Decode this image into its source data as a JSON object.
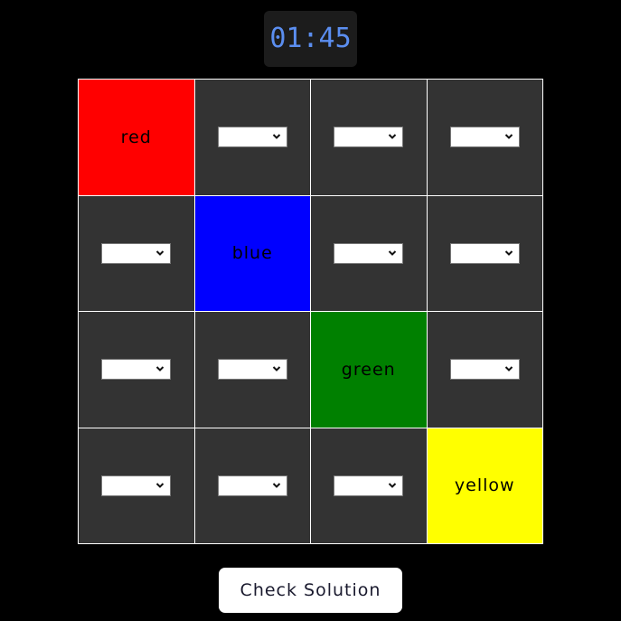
{
  "timer": {
    "value": "01:45",
    "color": "#5b8ef0"
  },
  "grid": {
    "rows": [
      [
        {
          "type": "fixed",
          "label": "red",
          "color": "#ff0000"
        },
        {
          "type": "select",
          "value": ""
        },
        {
          "type": "select",
          "value": ""
        },
        {
          "type": "select",
          "value": ""
        }
      ],
      [
        {
          "type": "select",
          "value": ""
        },
        {
          "type": "fixed",
          "label": "blue",
          "color": "#0000ff"
        },
        {
          "type": "select",
          "value": ""
        },
        {
          "type": "select",
          "value": ""
        }
      ],
      [
        {
          "type": "select",
          "value": ""
        },
        {
          "type": "select",
          "value": ""
        },
        {
          "type": "fixed",
          "label": "green",
          "color": "#008000"
        },
        {
          "type": "select",
          "value": ""
        }
      ],
      [
        {
          "type": "select",
          "value": ""
        },
        {
          "type": "select",
          "value": ""
        },
        {
          "type": "select",
          "value": ""
        },
        {
          "type": "fixed",
          "label": "yellow",
          "color": "#ffff00"
        }
      ]
    ]
  },
  "actions": {
    "check_label": "Check Solution"
  }
}
